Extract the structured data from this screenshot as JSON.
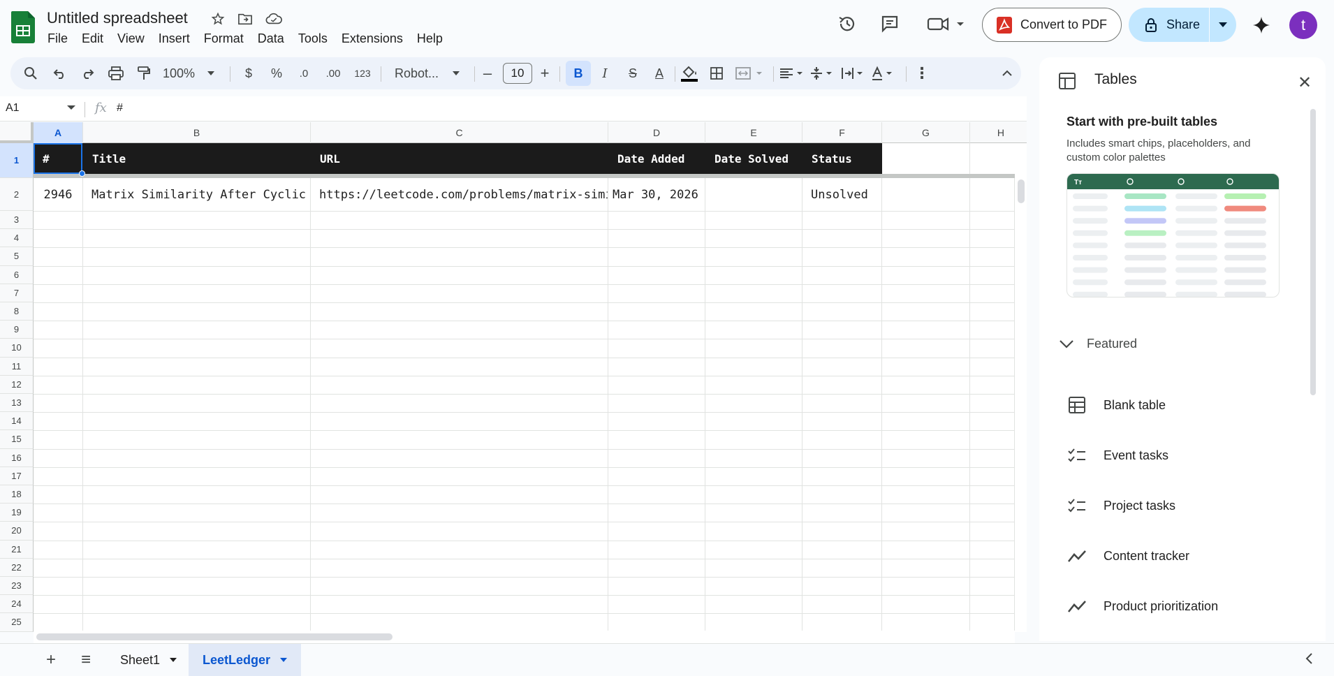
{
  "app": {
    "doc_title": "Untitled spreadsheet",
    "menus": [
      "File",
      "Edit",
      "View",
      "Insert",
      "Format",
      "Data",
      "Tools",
      "Extensions",
      "Help"
    ],
    "convert_pdf_label": "Convert to PDF",
    "share_label": "Share",
    "avatar_letter": "t"
  },
  "toolbar": {
    "zoom": "100%",
    "currency": "$",
    "percent": "%",
    "dec_decrease": ".0",
    "dec_increase": ".00",
    "number_format": "123",
    "font": "Robot...",
    "font_size": "10",
    "minus": "–",
    "plus": "+",
    "bold": "B",
    "italic": "I",
    "strike": "S",
    "text_color": "A",
    "more": "⋮"
  },
  "formula": {
    "cell_ref": "A1",
    "fx": "fx",
    "value": "#"
  },
  "grid": {
    "columns": [
      "A",
      "B",
      "C",
      "D",
      "E",
      "F",
      "G",
      "H"
    ],
    "rows": [
      "1",
      "2",
      "3",
      "4",
      "5",
      "6",
      "7",
      "8",
      "9",
      "10",
      "11",
      "12",
      "13",
      "14",
      "15",
      "16",
      "17",
      "18",
      "19",
      "20",
      "21",
      "22",
      "23",
      "24",
      "25"
    ],
    "header": [
      "#",
      "Title",
      "URL",
      "Date Added",
      "Date Solved",
      "Status"
    ],
    "data_row": [
      "2946",
      "Matrix Similarity After Cyclic Shifts",
      "https://leetcode.com/problems/matrix-similarity-after-cyclic-shifts/",
      "Mar 30, 2026",
      "",
      "Unsolved"
    ]
  },
  "sheets": {
    "tabs": [
      "Sheet1",
      "LeetLedger"
    ],
    "active": "LeetLedger",
    "add_label": "+",
    "list_label": "≡"
  },
  "panel": {
    "title": "Tables",
    "close": "✕",
    "heading": "Start with pre-built tables",
    "description": "Includes smart chips, placeholders, and custom color palettes",
    "featured_label": "Featured",
    "templates": [
      {
        "label": "Blank table",
        "icon": "table-icon"
      },
      {
        "label": "Event tasks",
        "icon": "checklist-icon"
      },
      {
        "label": "Project tasks",
        "icon": "checklist-icon"
      },
      {
        "label": "Content tracker",
        "icon": "trend-icon"
      },
      {
        "label": "Product prioritization",
        "icon": "trend-icon"
      }
    ]
  },
  "colors": {
    "accent": "#0b57d0",
    "header_row_bg": "#1b1b1b",
    "share_bg": "#c2e7ff",
    "sheets_green": "#188038"
  }
}
